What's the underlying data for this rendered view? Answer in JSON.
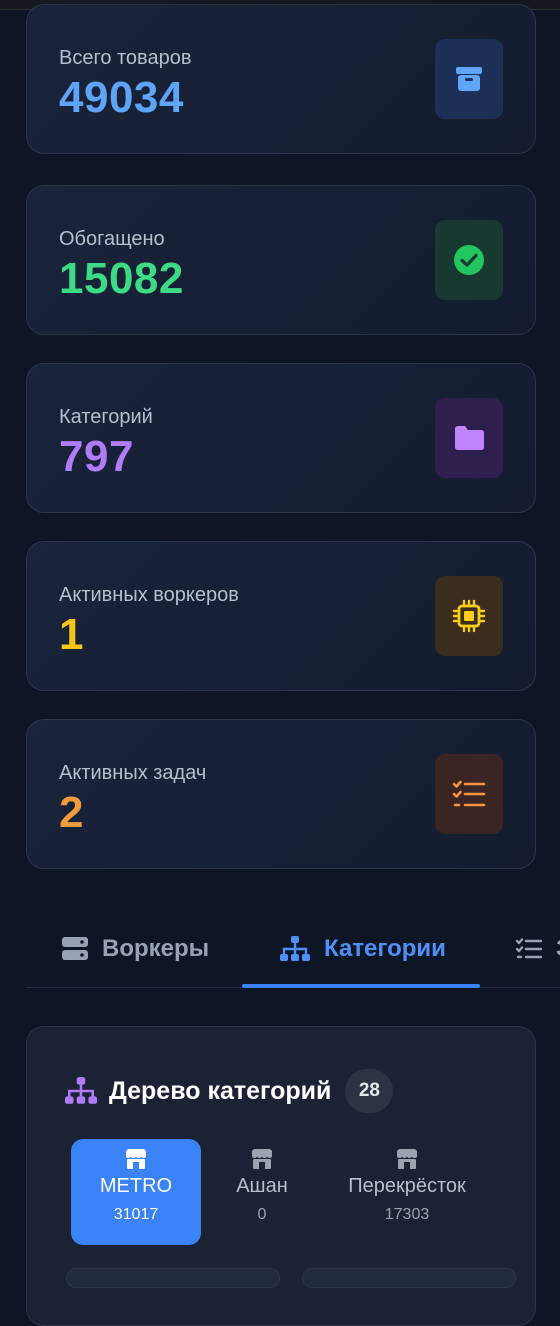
{
  "stats": [
    {
      "label": "Всего товаров",
      "value": "49034",
      "color": "#5ea5f8",
      "icon": "package-icon",
      "icon_bg": "#1c2f57"
    },
    {
      "label": "Обогащено",
      "value": "15082",
      "color": "#3ddc84",
      "icon": "check-circle-icon",
      "icon_bg": "#17392f"
    },
    {
      "label": "Категорий",
      "value": "797",
      "color": "#b07cf5",
      "icon": "folder-icon",
      "icon_bg": "#2f1f4f"
    },
    {
      "label": "Активных воркеров",
      "value": "1",
      "color": "#f5c518",
      "icon": "cpu-chip-icon",
      "icon_bg": "#3a2d1d"
    },
    {
      "label": "Активных задач",
      "value": "2",
      "color": "#f39a3d",
      "icon": "task-list-icon",
      "icon_bg": "#3b2524"
    }
  ],
  "tabs": [
    {
      "label": "Воркеры",
      "icon": "server-icon",
      "active": false
    },
    {
      "label": "Категории",
      "icon": "sitemap-icon",
      "active": true
    },
    {
      "label": "З",
      "icon": "task-list-icon",
      "active": false
    }
  ],
  "tree": {
    "title": "Дерево категорий",
    "count": "28",
    "stores": [
      {
        "name": "METRO",
        "count": "31017",
        "active": true,
        "icon": "store-icon"
      },
      {
        "name": "Ашан",
        "count": "0",
        "active": false,
        "icon": "store-icon"
      },
      {
        "name": "Перекрёсток",
        "count": "17303",
        "active": false,
        "icon": "store-icon"
      }
    ]
  },
  "colors": {
    "accent": "#3b82f6",
    "background": "#0e1626",
    "card": "#19233a"
  }
}
